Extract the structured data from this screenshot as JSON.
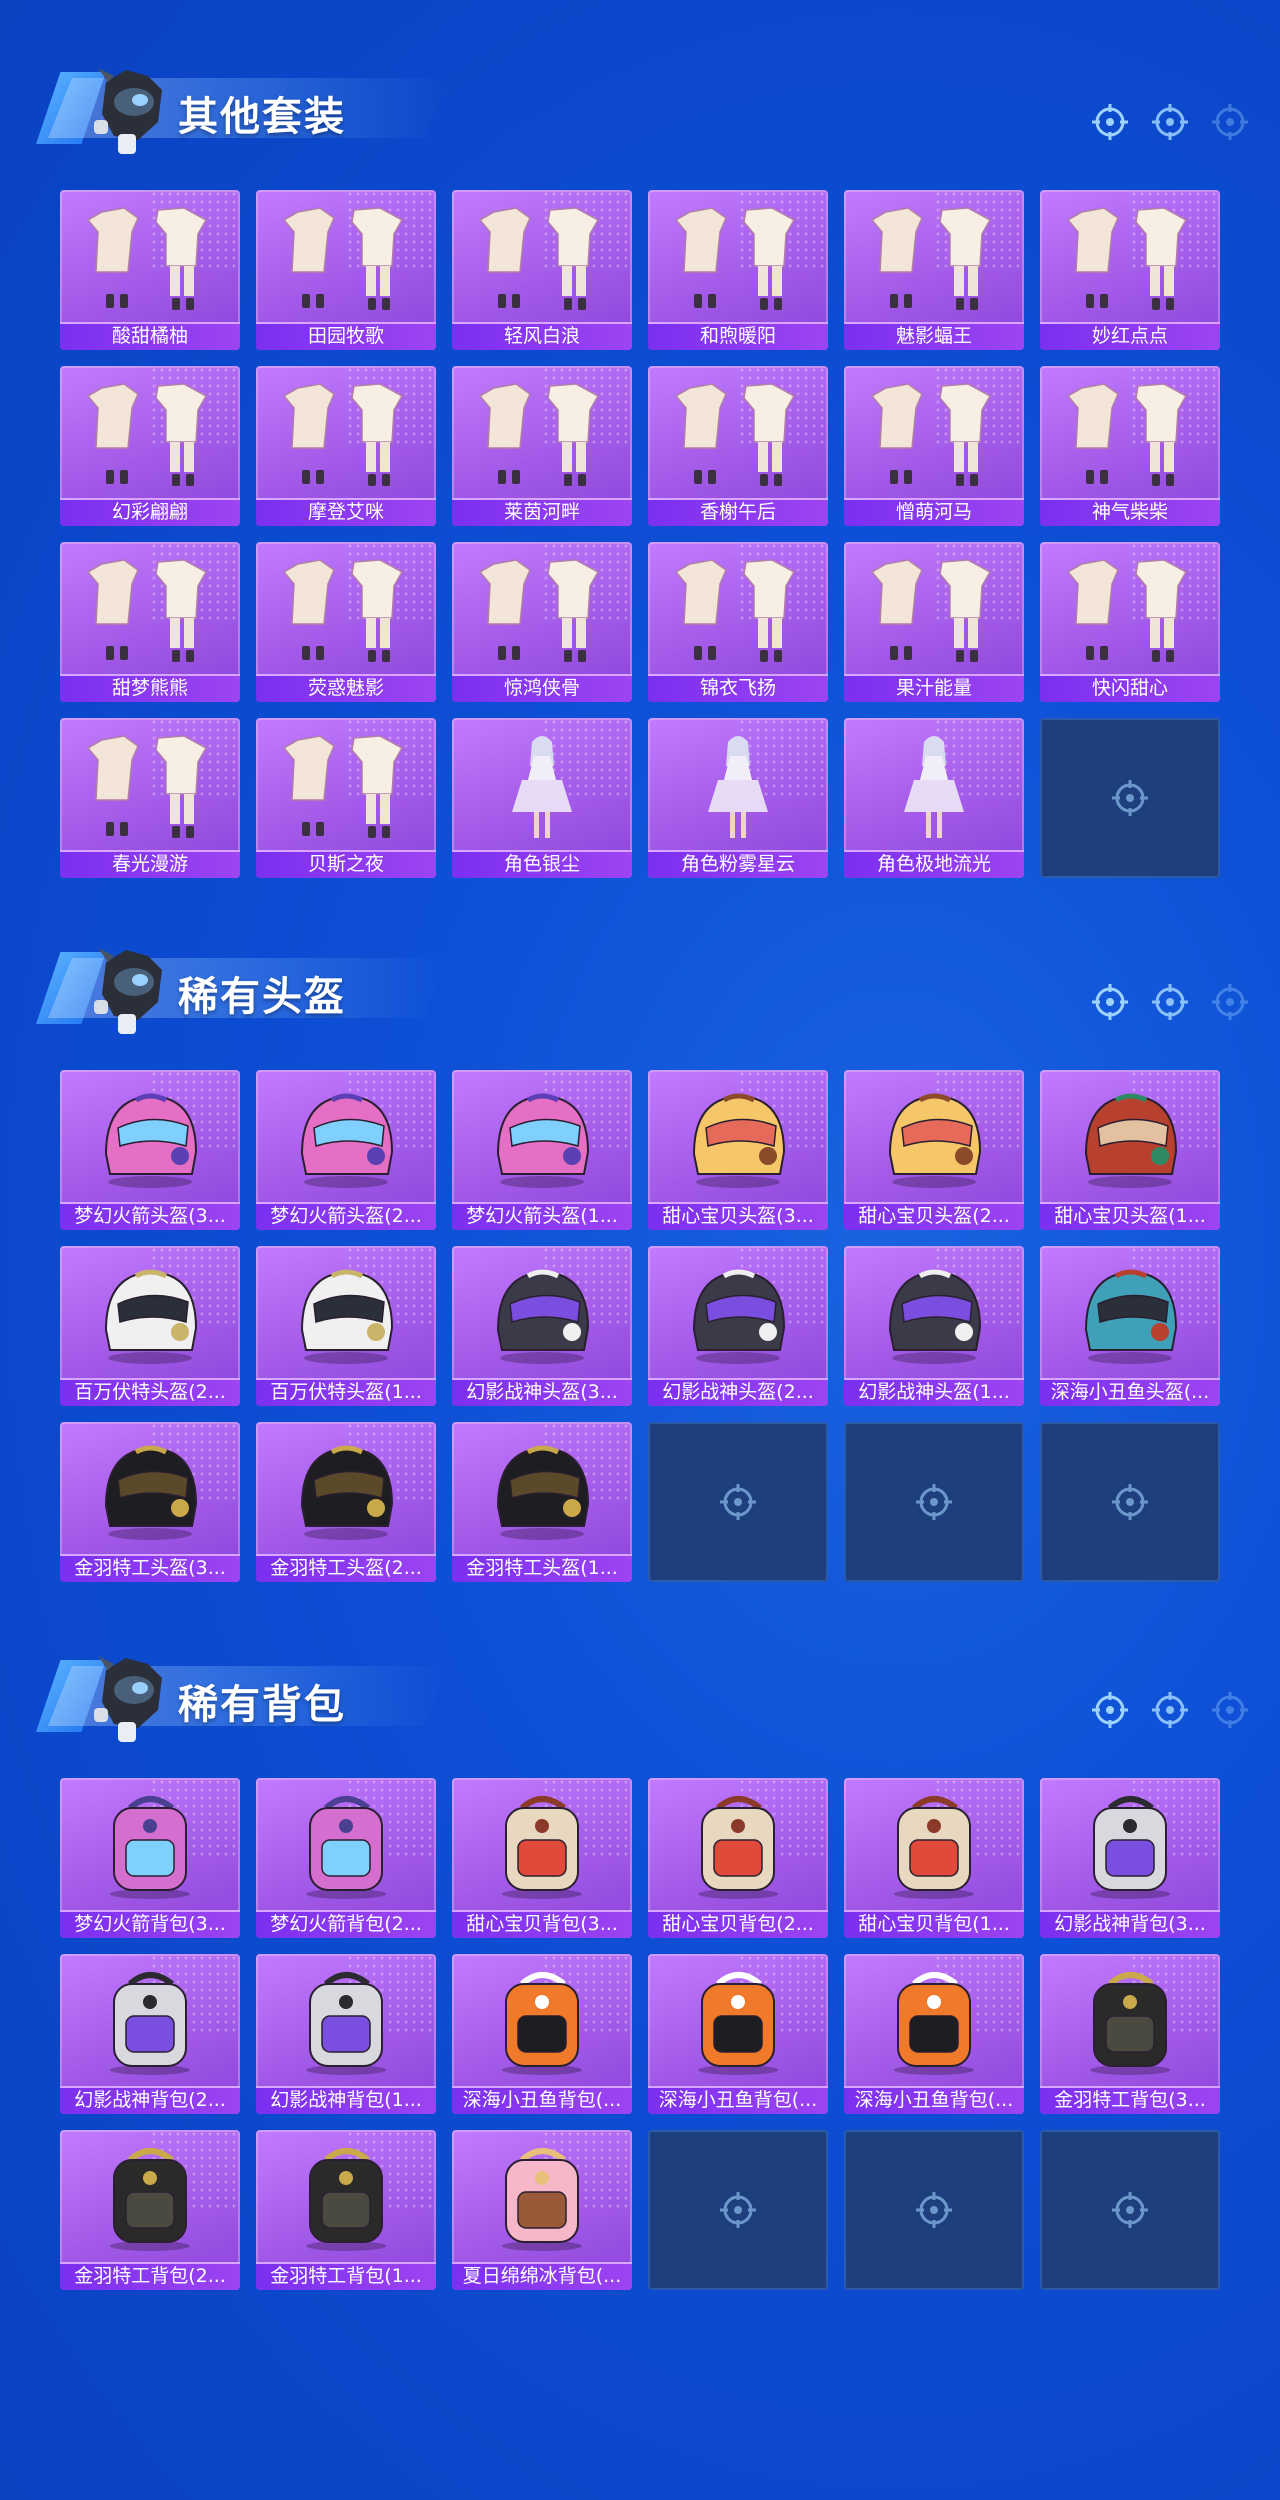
{
  "sections": [
    {
      "title": "其他套装",
      "items": [
        "酸甜橘柚",
        "田园牧歌",
        "轻风白浪",
        "和煦暖阳",
        "魅影蝠王",
        "妙红点点",
        "幻彩翩翩",
        "摩登艾咪",
        "莱茵河畔",
        "香榭午后",
        "憎萌河马",
        "神气柴柴",
        "甜梦熊熊",
        "荧惑魅影",
        "惊鸿侠骨",
        "锦衣飞扬",
        "果汁能量",
        "快闪甜心",
        "春光漫游",
        "贝斯之夜",
        "角色银尘",
        "角色粉雾星云",
        "角色极地流光"
      ],
      "empty_slots": 1,
      "art": [
        "outfit",
        "outfit",
        "outfit",
        "outfit",
        "outfit",
        "outfit",
        "outfit",
        "outfit",
        "outfit",
        "outfit",
        "outfit",
        "outfit",
        "outfit",
        "outfit",
        "outfit",
        "outfit",
        "outfit",
        "outfit",
        "outfit",
        "outfit",
        "character",
        "character",
        "character"
      ]
    },
    {
      "title": "稀有头盔",
      "items": [
        "梦幻火箭头盔(3...",
        "梦幻火箭头盔(2...",
        "梦幻火箭头盔(1...",
        "甜心宝贝头盔(3...",
        "甜心宝贝头盔(2...",
        "甜心宝贝头盔(1...",
        "百万伏特头盔(2...",
        "百万伏特头盔(1...",
        "幻影战神头盔(3...",
        "幻影战神头盔(2...",
        "幻影战神头盔(1...",
        "深海小丑鱼头盔(...",
        "金羽特工头盔(3...",
        "金羽特工头盔(2...",
        "金羽特工头盔(1..."
      ],
      "empty_slots": 3,
      "art": [
        "helmet-pink",
        "helmet-pink",
        "helmet-pink",
        "helmet-cake",
        "helmet-cake",
        "helmet-red",
        "helmet-white",
        "helmet-white",
        "helmet-dark",
        "helmet-dark",
        "helmet-dark",
        "helmet-teal",
        "helmet-black",
        "helmet-black",
        "helmet-black"
      ]
    },
    {
      "title": "稀有背包",
      "items": [
        "梦幻火箭背包(3...",
        "梦幻火箭背包(2...",
        "甜心宝贝背包(3...",
        "甜心宝贝背包(2...",
        "甜心宝贝背包(1...",
        "幻影战神背包(3...",
        "幻影战神背包(2...",
        "幻影战神背包(1...",
        "深海小丑鱼背包(...",
        "深海小丑鱼背包(...",
        "深海小丑鱼背包(...",
        "金羽特工背包(3...",
        "金羽特工背包(2...",
        "金羽特工背包(1...",
        "夏日绵绵冰背包(..."
      ],
      "empty_slots": 3,
      "art": [
        "pack-pink",
        "pack-pink",
        "pack-cake",
        "pack-cake",
        "pack-cake",
        "pack-grey",
        "pack-grey",
        "pack-grey",
        "pack-fish",
        "pack-fish",
        "pack-fish",
        "pack-black",
        "pack-black",
        "pack-black",
        "pack-icecream"
      ]
    }
  ],
  "icons": {
    "crosshair": "crosshair-icon",
    "mascot": "mascot-icon"
  },
  "colors": {
    "background": "#0d4fd6",
    "card": "#a35ae8",
    "label_bar": "#7b2ff0",
    "empty_slot": "#1d3f7e"
  }
}
